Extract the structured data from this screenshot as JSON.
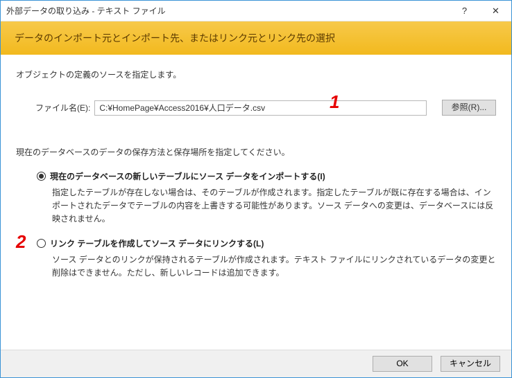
{
  "window": {
    "title": "外部データの取り込み - テキスト ファイル",
    "help_icon": "?",
    "close_icon": "✕"
  },
  "header": {
    "text": "データのインポート元とインポート先、またはリンク元とリンク先の選択"
  },
  "intro": "オブジェクトの定義のソースを指定します。",
  "file": {
    "label": "ファイル名(E):",
    "value": "C:¥HomePage¥Access2016¥人口データ.csv",
    "browse": "参照(R)..."
  },
  "instruction": "現在のデータベースのデータの保存方法と保存場所を指定してください。",
  "options": [
    {
      "title": "現在のデータベースの新しいテーブルにソース データをインポートする(I)",
      "desc": "指定したテーブルが存在しない場合は、そのテーブルが作成されます。指定したテーブルが既に存在する場合は、インポートされたデータでテーブルの内容を上書きする可能性があります。ソース データへの変更は、データベースには反映されません。",
      "checked": true
    },
    {
      "title": "リンク テーブルを作成してソース データにリンクする(L)",
      "desc": "ソース データとのリンクが保持されるテーブルが作成されます。テキスト ファイルにリンクされているデータの変更と削除はできません。ただし、新しいレコードは追加できます。",
      "checked": false
    }
  ],
  "buttons": {
    "ok": "OK",
    "cancel": "キャンセル"
  },
  "annotations": {
    "a1": "1",
    "a2": "2"
  }
}
